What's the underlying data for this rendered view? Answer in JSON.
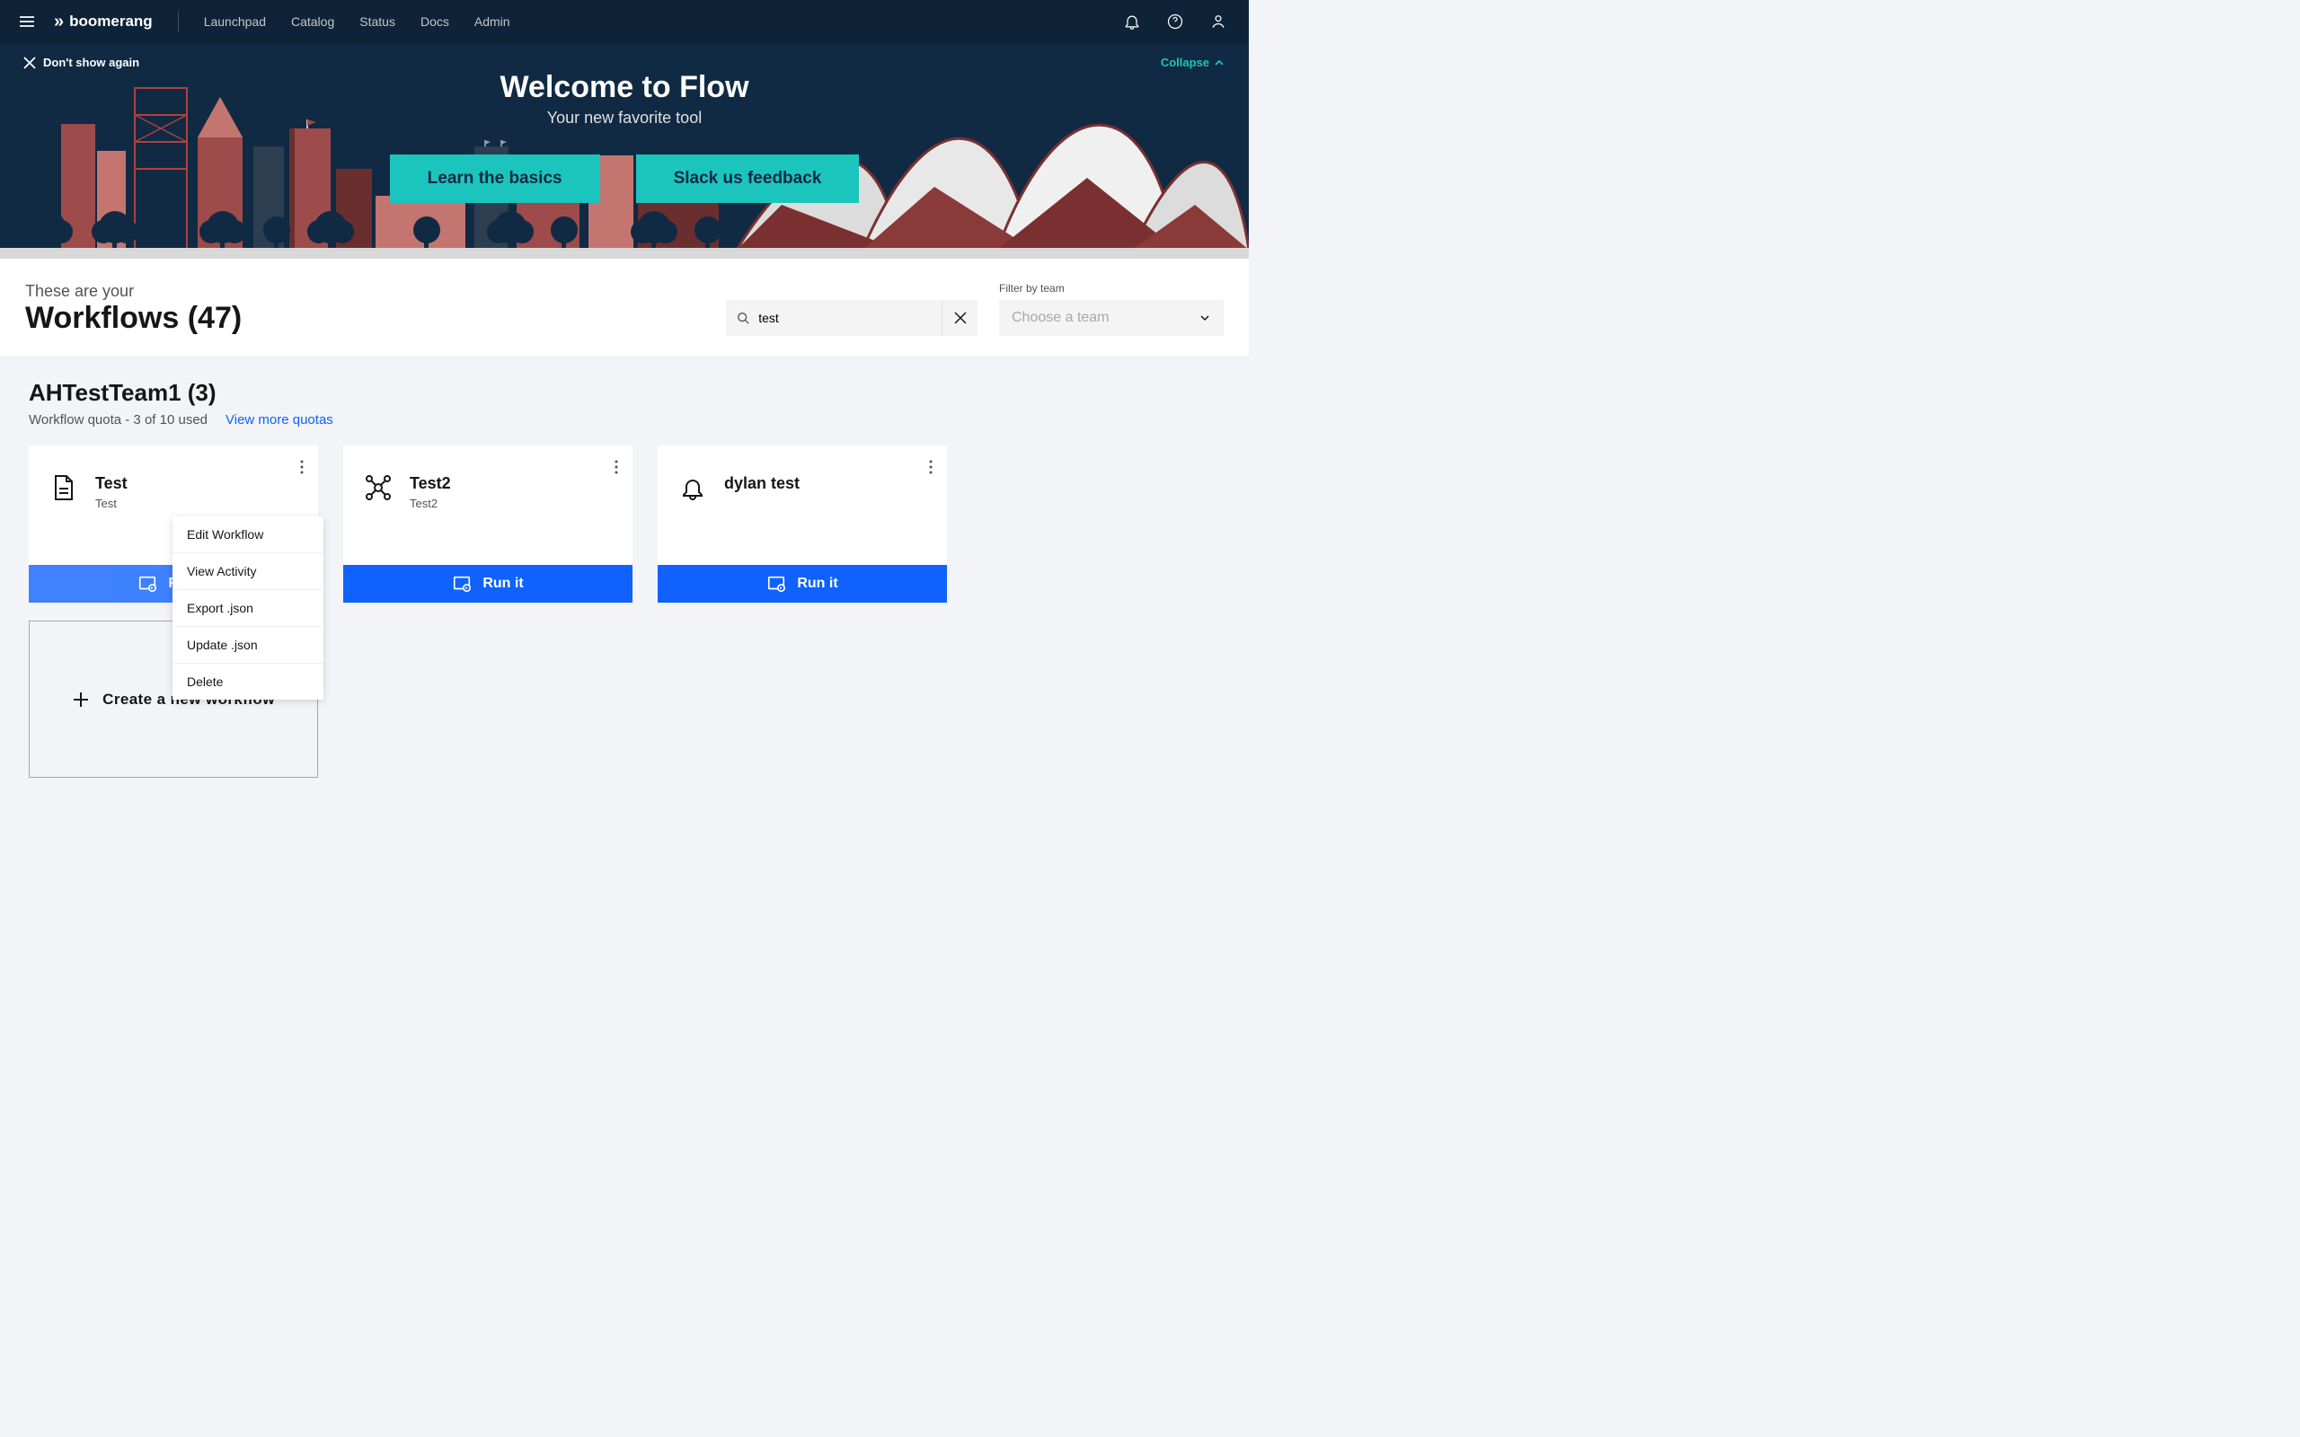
{
  "header": {
    "brand": "boomerang",
    "nav": [
      "Launchpad",
      "Catalog",
      "Status",
      "Docs",
      "Admin"
    ]
  },
  "hero": {
    "dismiss": "Don't show again",
    "collapse": "Collapse",
    "title": "Welcome to Flow",
    "subtitle": "Your new favorite tool",
    "learn_btn": "Learn the basics",
    "slack_btn": "Slack us feedback"
  },
  "page": {
    "sup": "These are your",
    "title": "Workflows (47)",
    "search_value": "test",
    "filter_label": "Filter by team",
    "filter_placeholder": "Choose a team"
  },
  "team": {
    "title": "AHTestTeam1 (3)",
    "quota": "Workflow quota - 3 of 10 used",
    "more": "View more quotas"
  },
  "cards": [
    {
      "title": "Test",
      "subtitle": "Test",
      "run": "Run it",
      "icon": "document"
    },
    {
      "title": "Test2",
      "subtitle": "Test2",
      "run": "Run it",
      "icon": "network"
    },
    {
      "title": "dylan test",
      "subtitle": "",
      "run": "Run it",
      "icon": "bell"
    }
  ],
  "new_card": "Create a new workflow",
  "menu": {
    "edit": "Edit Workflow",
    "view": "View Activity",
    "export": "Export .json",
    "update": "Update .json",
    "delete": "Delete"
  }
}
